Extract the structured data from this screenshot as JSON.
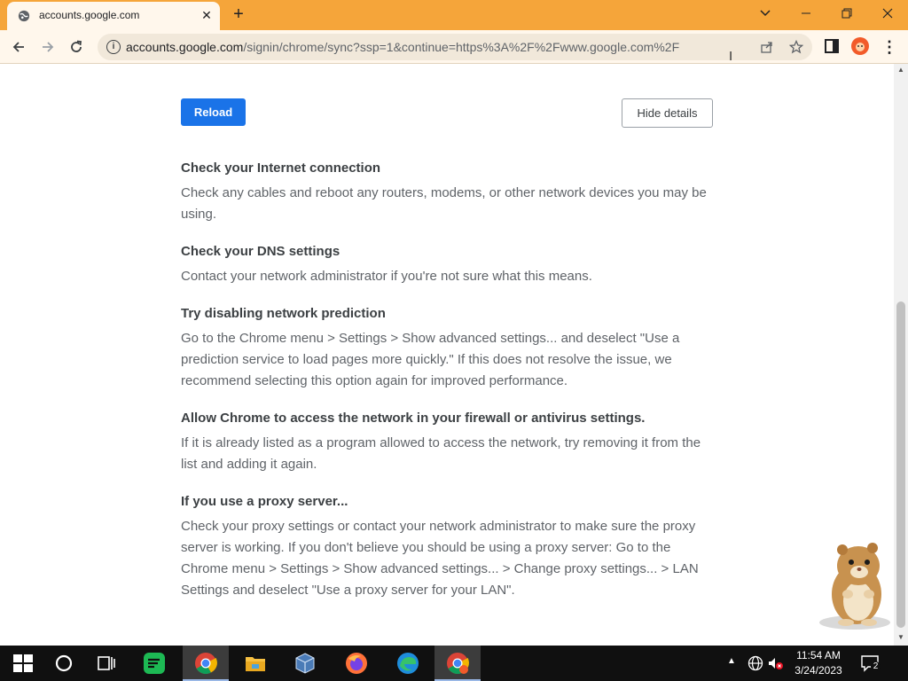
{
  "browser": {
    "tab": {
      "title": "accounts.google.com"
    },
    "window_controls": {
      "minimize": "—",
      "restore": "❐",
      "close": "✕",
      "tab_list": "⌄"
    },
    "url": {
      "host": "accounts.google.com",
      "path": "/signin/chrome/sync?ssp=1&continue=https%3A%2F%2Fwww.google.com%2F"
    }
  },
  "page": {
    "reload_label": "Reload",
    "details_label": "Hide details",
    "sections": [
      {
        "heading": "Check your Internet connection",
        "body": "Check any cables and reboot any routers, modems, or other network devices you may be using."
      },
      {
        "heading": "Check your DNS settings",
        "body": "Contact your network administrator if you're not sure what this means."
      },
      {
        "heading": "Try disabling network prediction",
        "body": "Go to the Chrome menu > Settings > Show advanced settings... and deselect \"Use a prediction service to load pages more quickly.\" If this does not resolve the issue, we recommend selecting this option again for improved performance."
      },
      {
        "heading": "Allow Chrome to access the network in your firewall or antivirus settings.",
        "body": "If it is already listed as a program allowed to access the network, try removing it from the list and adding it again."
      },
      {
        "heading": "If you use a proxy server...",
        "body": "Check your proxy settings or contact your network administrator to make sure the proxy server is working. If you don't believe you should be using a proxy server: Go to the Chrome menu > Settings > Show advanced settings... > Change proxy settings... > LAN Settings and deselect \"Use a proxy server for your LAN\"."
      }
    ]
  },
  "taskbar": {
    "items": [
      "start-icon",
      "cortana-icon",
      "task-view-icon",
      "green-app-icon",
      "chrome-icon",
      "file-explorer-icon",
      "virtualbox-icon",
      "firefox-icon",
      "edge-icon",
      "chrome-icon"
    ],
    "clock": {
      "time": "11:54 AM",
      "date": "3/24/2023"
    },
    "notification_count": "2"
  },
  "colors": {
    "titlebar": "#f5a53a",
    "toolbar": "#fff7ec",
    "accent_blue": "#1a73e8",
    "taskbar": "#101010"
  }
}
